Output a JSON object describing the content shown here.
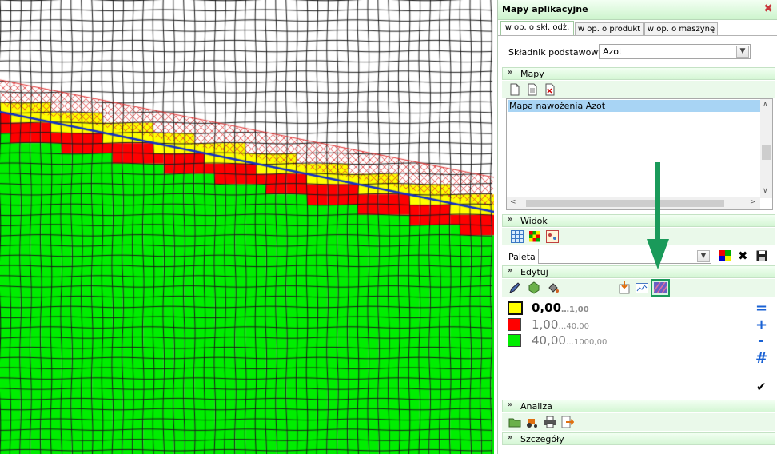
{
  "panel": {
    "title": "Mapy aplikacyjne",
    "tabs": [
      "w op. o skł. odż.",
      "w op. o produkt",
      "w op. o maszynę"
    ],
    "component_label": "Składnik podstawowy",
    "component_value": "Azot"
  },
  "sections": {
    "maps": "Mapy",
    "view": "Widok",
    "edit": "Edytuj",
    "analysis": "Analiza",
    "details": "Szczegóły"
  },
  "maps_list": [
    "Mapa nawożenia Azot"
  ],
  "palette_label": "Paleta",
  "palette_value": "",
  "legend": [
    {
      "value": "0,00",
      "range": "…1,00",
      "color": "#ffff00"
    },
    {
      "value": "1,00",
      "range": "…40,00",
      "color": "#ff0000"
    },
    {
      "value": "40,00",
      "range": "…1000,00",
      "color": "#00ee00"
    }
  ],
  "ops": [
    "=",
    "+",
    "-",
    "#"
  ],
  "icons": {
    "close": "close-icon",
    "annotation": "green-down-arrow"
  },
  "colors": {
    "field": "#00ee00",
    "mid": "#ff0000",
    "low": "#ffff00",
    "line": "#1030c8",
    "panel_header": "#cdf4cd"
  }
}
